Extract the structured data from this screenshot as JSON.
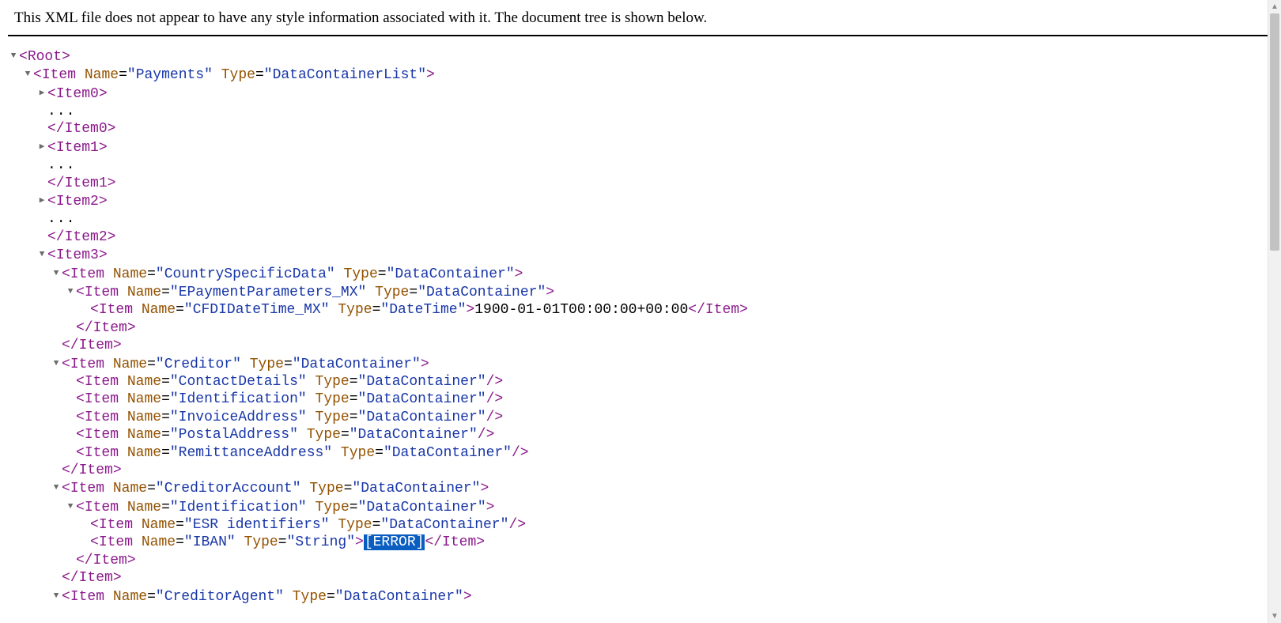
{
  "header_message": "This XML file does not appear to have any style information associated with it. The document tree is shown below.",
  "glyph_down": "▼",
  "glyph_right": "▶",
  "ellipsis": "...",
  "root": {
    "tag": "Root"
  },
  "payments": {
    "tag": "Item",
    "name": "Payments",
    "type": "DataContainerList"
  },
  "item0": {
    "open": "Item0",
    "close": "Item0"
  },
  "item1": {
    "open": "Item1",
    "close": "Item1"
  },
  "item2": {
    "open": "Item2",
    "close": "Item2"
  },
  "item3": {
    "open": "Item3"
  },
  "csd": {
    "tag": "Item",
    "name": "CountrySpecificData",
    "type": "DataContainer",
    "close": "Item"
  },
  "epay": {
    "tag": "Item",
    "name": "EPaymentParameters_MX",
    "type": "DataContainer",
    "close": "Item"
  },
  "cfdi": {
    "tag": "Item",
    "name": "CFDIDateTime_MX",
    "type": "DateTime",
    "value": "1900-01-01T00:00:00+00:00",
    "close": "Item"
  },
  "cred": {
    "tag": "Item",
    "name": "Creditor",
    "type": "DataContainer",
    "close": "Item"
  },
  "cred_children": [
    {
      "name": "ContactDetails",
      "type": "DataContainer"
    },
    {
      "name": "Identification",
      "type": "DataContainer"
    },
    {
      "name": "InvoiceAddress",
      "type": "DataContainer"
    },
    {
      "name": "PostalAddress",
      "type": "DataContainer"
    },
    {
      "name": "RemittanceAddress",
      "type": "DataContainer"
    }
  ],
  "credacct": {
    "tag": "Item",
    "name": "CreditorAccount",
    "type": "DataContainer",
    "close": "Item"
  },
  "ident": {
    "tag": "Item",
    "name": "Identification",
    "type": "DataContainer",
    "close": "Item"
  },
  "esr": {
    "tag": "Item",
    "name": "ESR identifiers",
    "type": "DataContainer"
  },
  "iban": {
    "tag": "Item",
    "name": "IBAN",
    "type": "String",
    "value": "[ERROR]",
    "close": "Item"
  },
  "credagent": {
    "tag": "Item",
    "name": "CreditorAgent",
    "type": "DataContainer"
  }
}
